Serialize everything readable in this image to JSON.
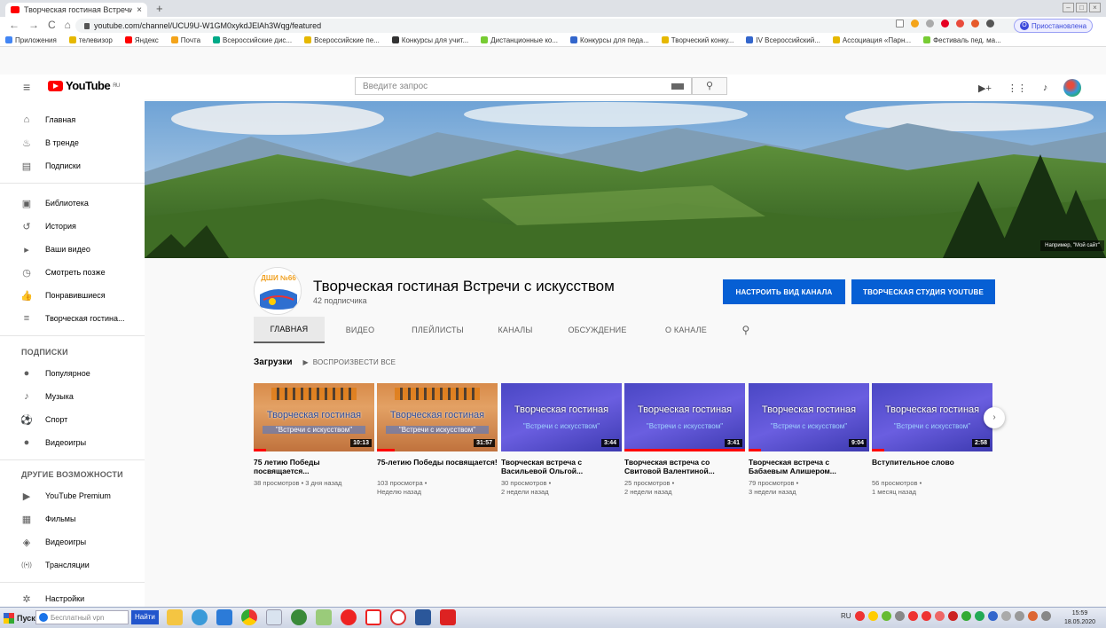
{
  "browser": {
    "tab_title": "Творческая гостиная Встречи с",
    "tab_close": "×",
    "new_tab": "+",
    "back": "←",
    "forward": "→",
    "reload": "C",
    "home": "⌂",
    "url": "youtube.com/channel/UCU9U-W1GM0xykdJElAh3Wqg/featured",
    "paused_label": "Приостановлена",
    "paused_badge": "O",
    "bookmarks": [
      "Приложения",
      "телевизор",
      "Яндекс",
      "Почта",
      "Всероссийские дис...",
      "Всероссийские пе...",
      "Конкурсы для учит...",
      "Дистанционные ко...",
      "Конкурсы для педа...",
      "Творческий конку...",
      "IV Всероссийский...",
      "Ассоциация «Парн...",
      "Фестиваль пед. ма..."
    ]
  },
  "youtube": {
    "logo_text": "YouTube",
    "logo_region": "RU",
    "search_placeholder": "Введите запрос"
  },
  "sidebar": {
    "main": [
      {
        "label": "Главная",
        "icon": "home-icon",
        "glyph": "⌂"
      },
      {
        "label": "В тренде",
        "icon": "trending-icon",
        "glyph": "♨"
      },
      {
        "label": "Подписки",
        "icon": "subscriptions-icon",
        "glyph": "▤"
      }
    ],
    "library": [
      {
        "label": "Библиотека",
        "icon": "library-icon",
        "glyph": "▣"
      },
      {
        "label": "История",
        "icon": "history-icon",
        "glyph": "↺"
      },
      {
        "label": "Ваши видео",
        "icon": "your-videos-icon",
        "glyph": "▸"
      },
      {
        "label": "Смотреть позже",
        "icon": "watch-later-icon",
        "glyph": "◷"
      },
      {
        "label": "Понравившиеся",
        "icon": "liked-icon",
        "glyph": "👍"
      },
      {
        "label": "Творческая гостина...",
        "icon": "playlist-icon",
        "glyph": "≡"
      }
    ],
    "subscriptions_title": "ПОДПИСКИ",
    "subscriptions": [
      {
        "label": "Популярное",
        "icon": "popular-icon",
        "glyph": "●"
      },
      {
        "label": "Музыка",
        "icon": "music-icon",
        "glyph": "♪"
      },
      {
        "label": "Спорт",
        "icon": "sport-icon",
        "glyph": "⚽"
      },
      {
        "label": "Видеоигры",
        "icon": "gaming-icon",
        "glyph": "●"
      }
    ],
    "more_title": "ДРУГИЕ ВОЗМОЖНОСТИ",
    "more": [
      {
        "label": "YouTube Premium",
        "icon": "premium-icon",
        "glyph": "▶"
      },
      {
        "label": "Фильмы",
        "icon": "movies-icon",
        "glyph": "▦"
      },
      {
        "label": "Видеоигры",
        "icon": "gamepad-icon",
        "glyph": "◈"
      },
      {
        "label": "Трансляции",
        "icon": "live-icon",
        "glyph": "((•))"
      }
    ],
    "settings": {
      "label": "Настройки",
      "icon": "settings-icon",
      "glyph": "✲"
    }
  },
  "channel": {
    "banner_hint": "Например, \"Мой сайт\"",
    "avatar_text": "ДШИ №66",
    "name": "Творческая гостиная Встречи с искусством",
    "subscribers": "42 подписчика",
    "customize_button": "НАСТРОИТЬ ВИД КАНАЛА",
    "studio_button": "ТВОРЧЕСКАЯ СТУДИЯ YOUTUBE",
    "tabs": [
      "ГЛАВНАЯ",
      "ВИДЕО",
      "ПЛЕЙЛИСТЫ",
      "КАНАЛЫ",
      "ОБСУЖДЕНИЕ",
      "О КАНАЛЕ"
    ],
    "active_tab": "ГЛАВНАЯ",
    "accent_color": "#065fd4"
  },
  "uploads": {
    "label": "Загрузки",
    "play_all": "ВОСПРОИЗВЕСТИ ВСЕ",
    "videos": [
      {
        "title": "75 летию Победы посвящается...",
        "meta1": "38 просмотров • 3 дня назад",
        "meta2": "",
        "duration": "10:13",
        "thumb_style": "orange",
        "thumb_line1": "Творческая гостиная",
        "thumb_line2": "\"Встречи с искусством\"",
        "watched": 0.1
      },
      {
        "title": "75-летию Победы посвящается!",
        "meta1": "103 просмотра •",
        "meta2": "Неделю назад",
        "duration": "31:57",
        "thumb_style": "orange",
        "thumb_line1": "Творческая гостиная",
        "thumb_line2": "\"Встречи с искусством\"",
        "watched": 0.15
      },
      {
        "title": "Творческая встреча с Васильевой Ольгой...",
        "meta1": "30 просмотров •",
        "meta2": "2 недели назад",
        "duration": "3:44",
        "thumb_style": "blue",
        "thumb_line1": "Творческая гостиная",
        "thumb_line2": "\"Встречи с искусством\"",
        "watched": 0
      },
      {
        "title": "Творческая встреча со Свитовой Валентиной...",
        "meta1": "25 просмотров •",
        "meta2": "2 недели назад",
        "duration": "3:41",
        "thumb_style": "blue",
        "thumb_line1": "Творческая гостиная",
        "thumb_line2": "\"Встречи с искусством\"",
        "watched": 1.0
      },
      {
        "title": "Творческая встреча с Бабаевым Алишером...",
        "meta1": "79 просмотров •",
        "meta2": "3 недели назад",
        "duration": "9:04",
        "thumb_style": "blue",
        "thumb_line1": "Творческая гостиная",
        "thumb_line2": "\"Встречи с искусством\"",
        "watched": 0.1
      },
      {
        "title": "Вступительное слово",
        "meta1": "56 просмотров •",
        "meta2": "1 месяц назад",
        "duration": "2:58",
        "thumb_style": "blue",
        "thumb_line1": "Творческая гостиная",
        "thumb_line2": "\"Встречи с искусством\"",
        "watched": 0.1
      }
    ]
  },
  "taskbar": {
    "start_label": "Пуск",
    "vpn_label": "Бесплатный vpn",
    "find_button": "Найти",
    "lang": "RU",
    "time": "15:59",
    "date": "18.05.2020"
  }
}
